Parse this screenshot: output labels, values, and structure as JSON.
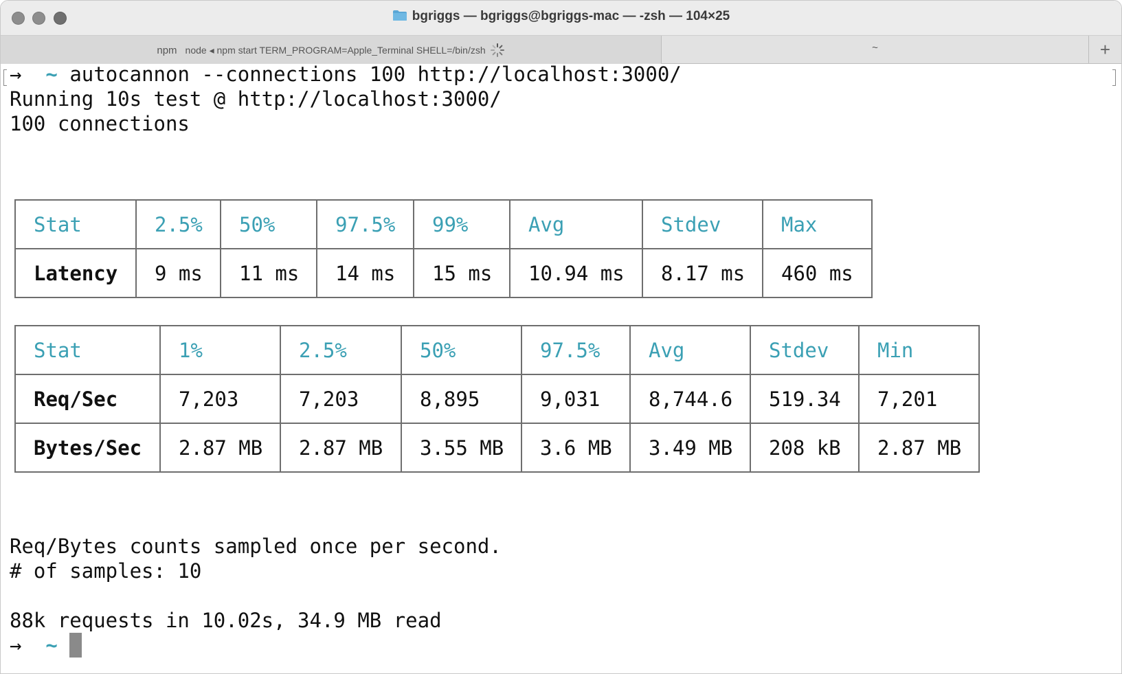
{
  "window": {
    "title": "bgriggs — bgriggs@bgriggs-mac — -zsh — 104×25"
  },
  "tabs": {
    "active": {
      "process": "npm",
      "command": "node ◂ npm start TERM_PROGRAM=Apple_Terminal SHELL=/bin/zsh"
    },
    "inactive": {
      "label": "~"
    },
    "add_label": "+"
  },
  "terminal": {
    "prompt_arrow": "→",
    "prompt_tilde": "~",
    "command": "autocannon --connections 100 http://localhost:3000/",
    "line_running": "Running 10s test @ http://localhost:3000/",
    "line_connections": "100 connections",
    "line_sampled": "Req/Bytes counts sampled once per second.",
    "line_samples": "# of samples: 10",
    "line_summary": "88k requests in 10.02s, 34.9 MB read"
  },
  "latency_table": {
    "headers": [
      "Stat",
      "2.5%",
      "50%",
      "97.5%",
      "99%",
      "Avg",
      "Stdev",
      "Max"
    ],
    "rows": [
      [
        "Latency",
        "9 ms",
        "11 ms",
        "14 ms",
        "15 ms",
        "10.94 ms",
        "8.17 ms",
        "460 ms"
      ]
    ]
  },
  "throughput_table": {
    "headers": [
      "Stat",
      "1%",
      "2.5%",
      "50%",
      "97.5%",
      "Avg",
      "Stdev",
      "Min"
    ],
    "rows": [
      [
        "Req/Sec",
        "7,203",
        "7,203",
        "8,895",
        "9,031",
        "8,744.6",
        "519.34",
        "7,201"
      ],
      [
        "Bytes/Sec",
        "2.87 MB",
        "2.87 MB",
        "3.55 MB",
        "3.6 MB",
        "3.49 MB",
        "208 kB",
        "2.87 MB"
      ]
    ]
  },
  "colors": {
    "header_text": "#3ba0b4",
    "border": "#6e6e6e",
    "cursor": "#8a8a8a"
  }
}
